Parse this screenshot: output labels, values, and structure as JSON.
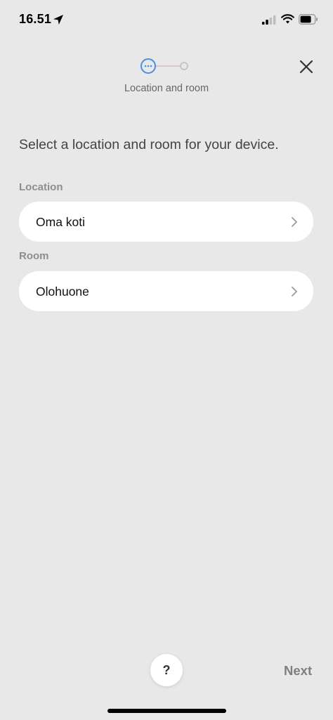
{
  "status_bar": {
    "time": "16.51",
    "icons": [
      "location-arrow-icon",
      "signal-icon",
      "wifi-icon",
      "battery-icon"
    ]
  },
  "stepper": {
    "step_label": "Location and room",
    "current_step": 1,
    "total_steps": 2,
    "active_color": "#4a90e2"
  },
  "prompt": "Select a location and room for your device.",
  "location": {
    "label": "Location",
    "value": "Oma koti"
  },
  "room": {
    "label": "Room",
    "value": "Olohuone"
  },
  "footer": {
    "help_label": "?",
    "next_label": "Next"
  }
}
